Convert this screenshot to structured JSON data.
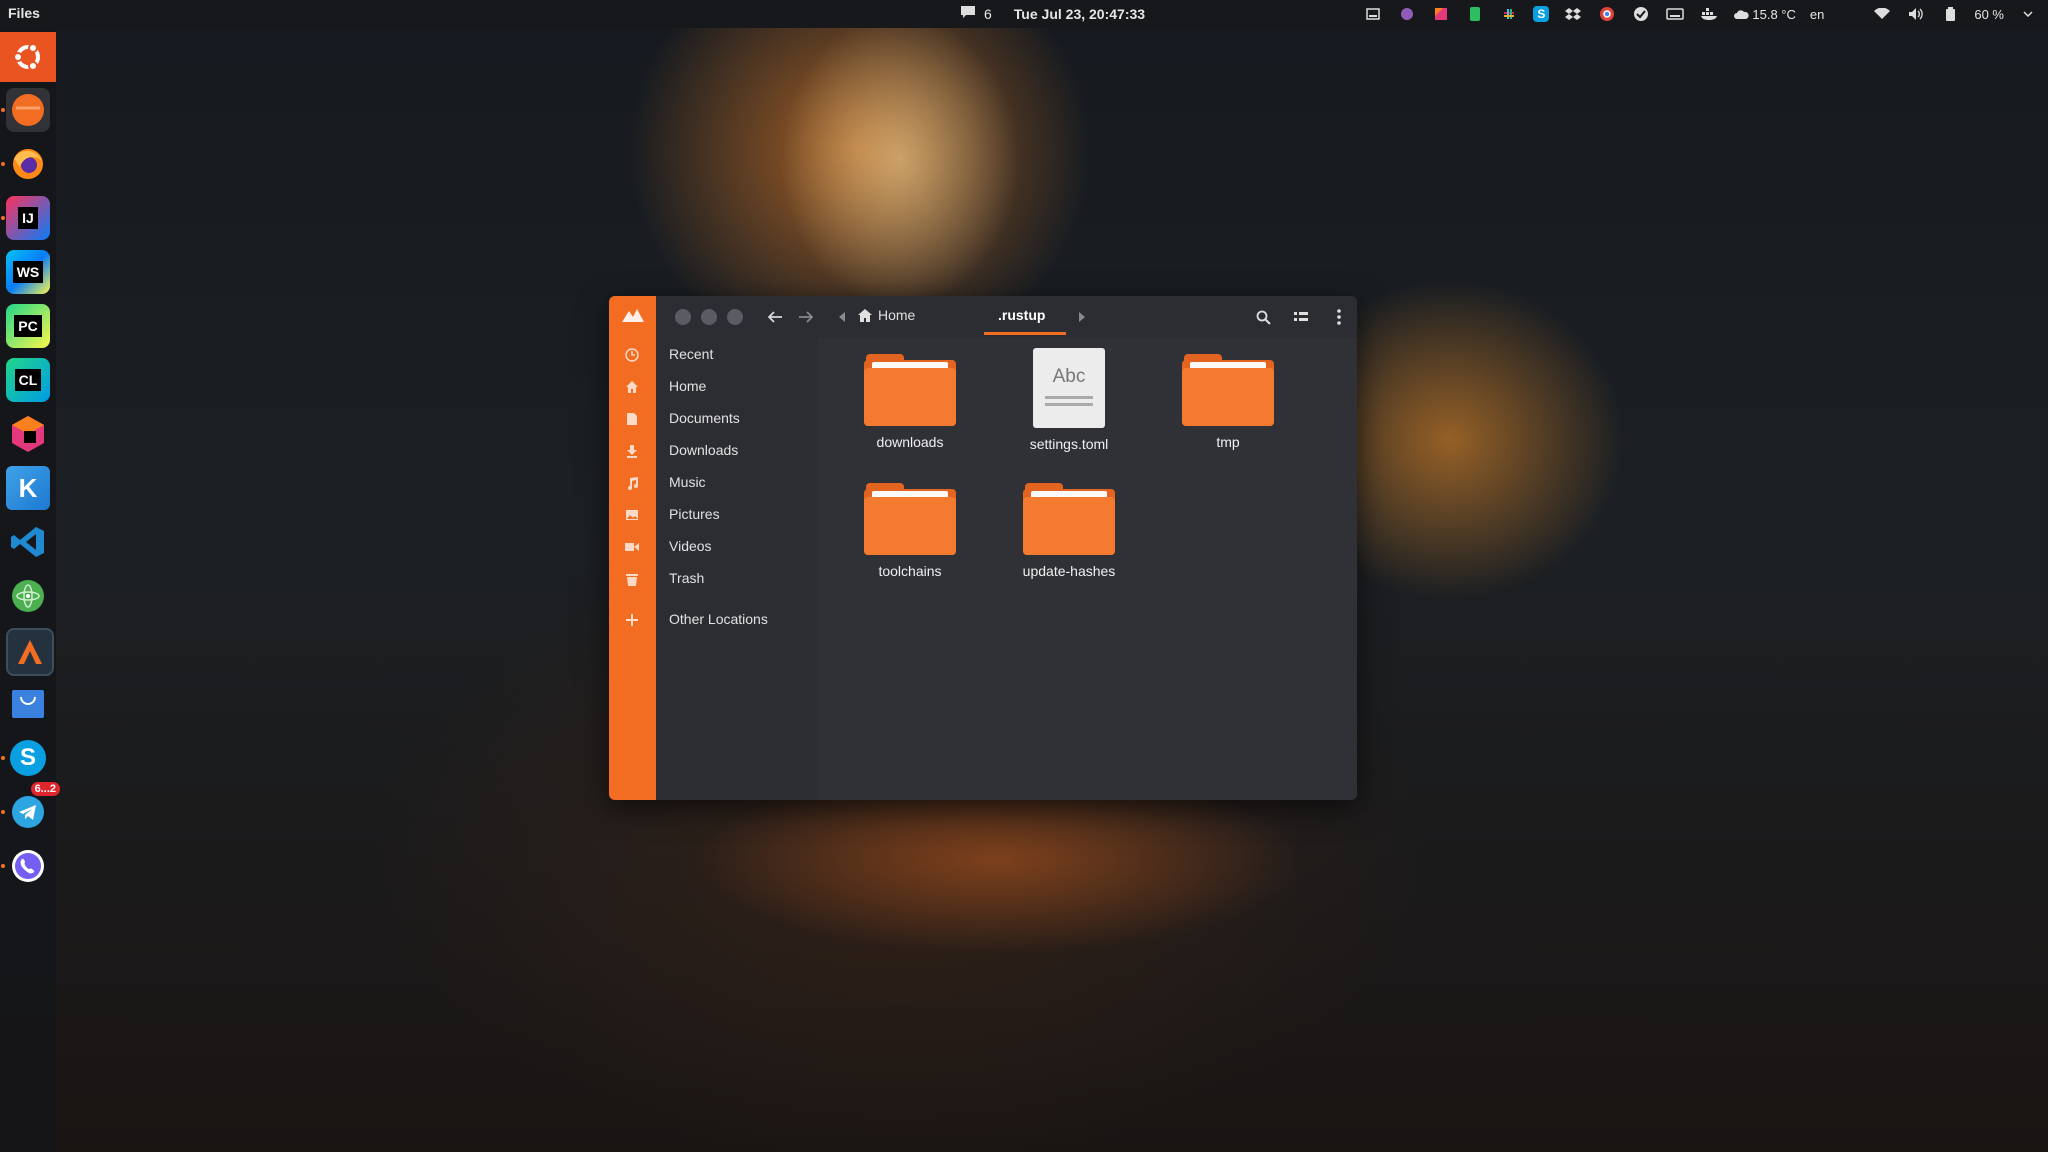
{
  "topbar": {
    "app_name": "Files",
    "notification_count": "6",
    "clock": "Tue Jul 23, 20:47:33",
    "weather": "15.8 °C",
    "language": "en",
    "battery": "60 %"
  },
  "dock": {
    "items": [
      {
        "name": "Show Applications"
      },
      {
        "name": "Files"
      },
      {
        "name": "Firefox"
      },
      {
        "name": "IntelliJ IDEA",
        "text": "IJ"
      },
      {
        "name": "WebStorm",
        "text": "WS"
      },
      {
        "name": "PyCharm",
        "text": "PC"
      },
      {
        "name": "CLion",
        "text": "CL"
      },
      {
        "name": "JetBrains Toolbox"
      },
      {
        "name": "Kotlin",
        "text": "K"
      },
      {
        "name": "Visual Studio Code"
      },
      {
        "name": "Atom"
      },
      {
        "name": "Anaconda Navigator"
      },
      {
        "name": "Mail"
      },
      {
        "name": "Skype",
        "text": "S"
      },
      {
        "name": "Telegram",
        "badge": "6...2"
      },
      {
        "name": "Viber"
      }
    ]
  },
  "window": {
    "breadcrumb": {
      "home": "Home",
      "current": ".rustup"
    },
    "sidebar": [
      {
        "label": "Recent",
        "icon": "clock-icon"
      },
      {
        "label": "Home",
        "icon": "home-icon"
      },
      {
        "label": "Documents",
        "icon": "document-icon"
      },
      {
        "label": "Downloads",
        "icon": "download-icon"
      },
      {
        "label": "Music",
        "icon": "music-icon"
      },
      {
        "label": "Pictures",
        "icon": "picture-icon"
      },
      {
        "label": "Videos",
        "icon": "video-icon"
      },
      {
        "label": "Trash",
        "icon": "trash-icon"
      },
      {
        "label": "Other Locations",
        "icon": "plus-icon"
      }
    ],
    "files": [
      {
        "name": "downloads",
        "type": "folder"
      },
      {
        "name": "settings.toml",
        "type": "text-document",
        "preview": "Abc"
      },
      {
        "name": "tmp",
        "type": "folder"
      },
      {
        "name": "toolchains",
        "type": "folder"
      },
      {
        "name": "update-hashes",
        "type": "folder"
      }
    ]
  },
  "colors": {
    "accent": "#f26c22",
    "folder": "#f47a2f",
    "window_bg": "#2d2f35"
  }
}
